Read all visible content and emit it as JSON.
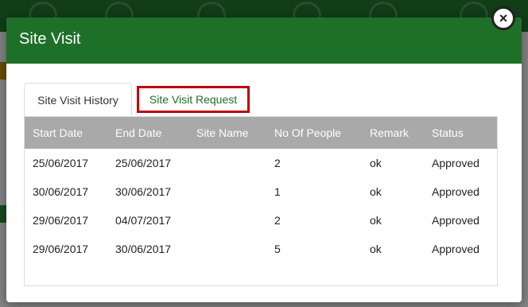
{
  "modal": {
    "title": "Site Visit",
    "close_label": "×"
  },
  "tabs": [
    {
      "label": "Site Visit History",
      "active": true
    },
    {
      "label": "Site Visit Request",
      "active": false
    }
  ],
  "table": {
    "headers": [
      "Start Date",
      "End Date",
      "Site Name",
      "No Of People",
      "Remark",
      "Status"
    ],
    "rows": [
      [
        "25/06/2017",
        "25/06/2017",
        "",
        "2",
        "ok",
        "Approved"
      ],
      [
        "30/06/2017",
        "30/06/2017",
        "",
        "1",
        "ok",
        "Approved"
      ],
      [
        "29/06/2017",
        "04/07/2017",
        "",
        "2",
        "ok",
        "Approved"
      ],
      [
        "29/06/2017",
        "30/06/2017",
        "",
        "5",
        "ok",
        "Approved"
      ]
    ]
  },
  "colors": {
    "header_green": "#1e6f27",
    "highlight_red": "#c0000c",
    "table_header_gray": "#a9a9a9"
  }
}
